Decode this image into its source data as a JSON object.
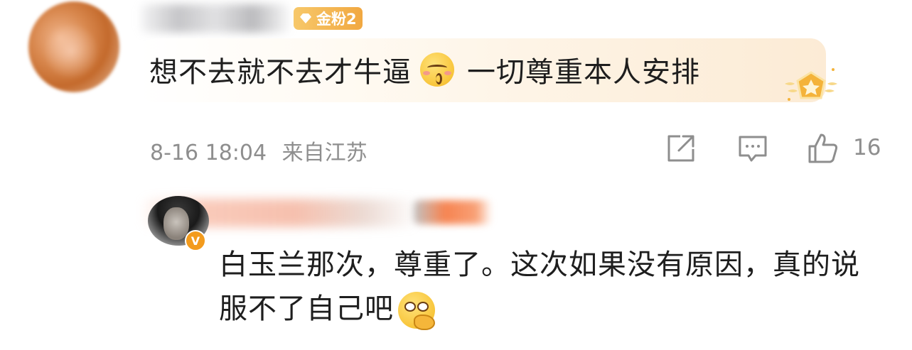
{
  "comment": {
    "fan_badge": "金粉2",
    "text_part1": "想不去就不去才牛逼",
    "emoji": "kissing-face-emoji",
    "text_part2": "一切尊重本人安排",
    "date": "8-16 18:04",
    "location": "来自江苏",
    "like_count": "16"
  },
  "reply": {
    "text": "白玉兰那次，尊重了。这次如果没有原因，真的说服不了自己吧",
    "emoji": "thinking-eye-roll-emoji",
    "verified_mark": "V"
  },
  "colors": {
    "meta_gray": "#8e8e8e",
    "badge_gold": "#f1a841",
    "verified_orange": "#f39b1d",
    "bubble_tint": "#fcebd5"
  }
}
